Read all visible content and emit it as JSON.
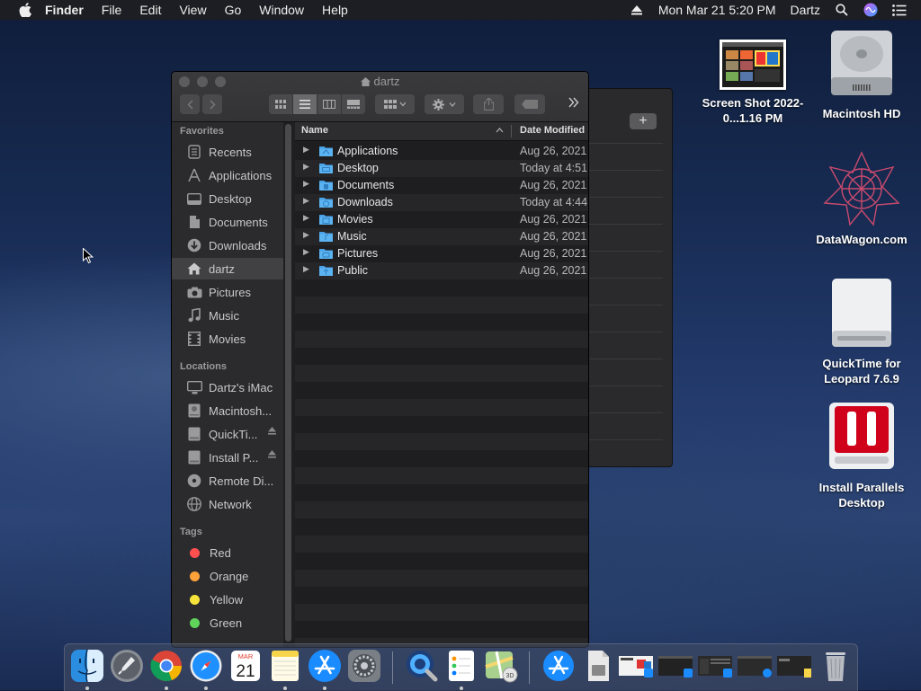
{
  "menubar": {
    "app": "Finder",
    "menus": [
      "File",
      "Edit",
      "View",
      "Go",
      "Window",
      "Help"
    ],
    "datetime": "Mon Mar 21  5:20 PM",
    "user": "Dartz"
  },
  "desktop": {
    "icons": [
      {
        "label": "Screen Shot 2022-0...1.16 PM",
        "icon": "screenshot-thumbnail"
      },
      {
        "label": "Macintosh HD",
        "icon": "hard-drive-icon"
      },
      {
        "label": "DataWagon.com",
        "icon": "datawagon-logo"
      },
      {
        "label": "QuickTime for Leopard 7.6.9",
        "icon": "disk-image-icon"
      },
      {
        "label": "Install Parallels Desktop",
        "icon": "parallels-installer-icon"
      }
    ]
  },
  "window": {
    "title": "dartz",
    "sidebar": {
      "favorites_header": "Favorites",
      "favorites": [
        "Recents",
        "Applications",
        "Desktop",
        "Documents",
        "Downloads",
        "dartz",
        "Pictures",
        "Music",
        "Movies"
      ],
      "locations_header": "Locations",
      "locations": [
        "Dartz's iMac",
        "Macintosh...",
        "QuickTi...",
        "Install P...",
        "Remote Di...",
        "Network"
      ],
      "tags_header": "Tags",
      "tags": [
        {
          "name": "Red",
          "color": "#ff4f4f"
        },
        {
          "name": "Orange",
          "color": "#ffa23a"
        },
        {
          "name": "Yellow",
          "color": "#f5e33b"
        },
        {
          "name": "Green",
          "color": "#5fd35a"
        }
      ]
    },
    "columns": {
      "name": "Name",
      "date": "Date Modified"
    },
    "files": [
      {
        "name": "Applications",
        "date": "Aug 26, 2021"
      },
      {
        "name": "Desktop",
        "date": "Today at 4:51"
      },
      {
        "name": "Documents",
        "date": "Aug 26, 2021"
      },
      {
        "name": "Downloads",
        "date": "Today at 4:44"
      },
      {
        "name": "Movies",
        "date": "Aug 26, 2021"
      },
      {
        "name": "Music",
        "date": "Aug 26, 2021"
      },
      {
        "name": "Pictures",
        "date": "Aug 26, 2021"
      },
      {
        "name": "Public",
        "date": "Aug 26, 2021"
      }
    ]
  },
  "dock": {
    "calendar": {
      "month": "MAR",
      "day": "21"
    }
  },
  "colors": {
    "folder": "#4aa3e8",
    "accent": "#0a84ff"
  }
}
